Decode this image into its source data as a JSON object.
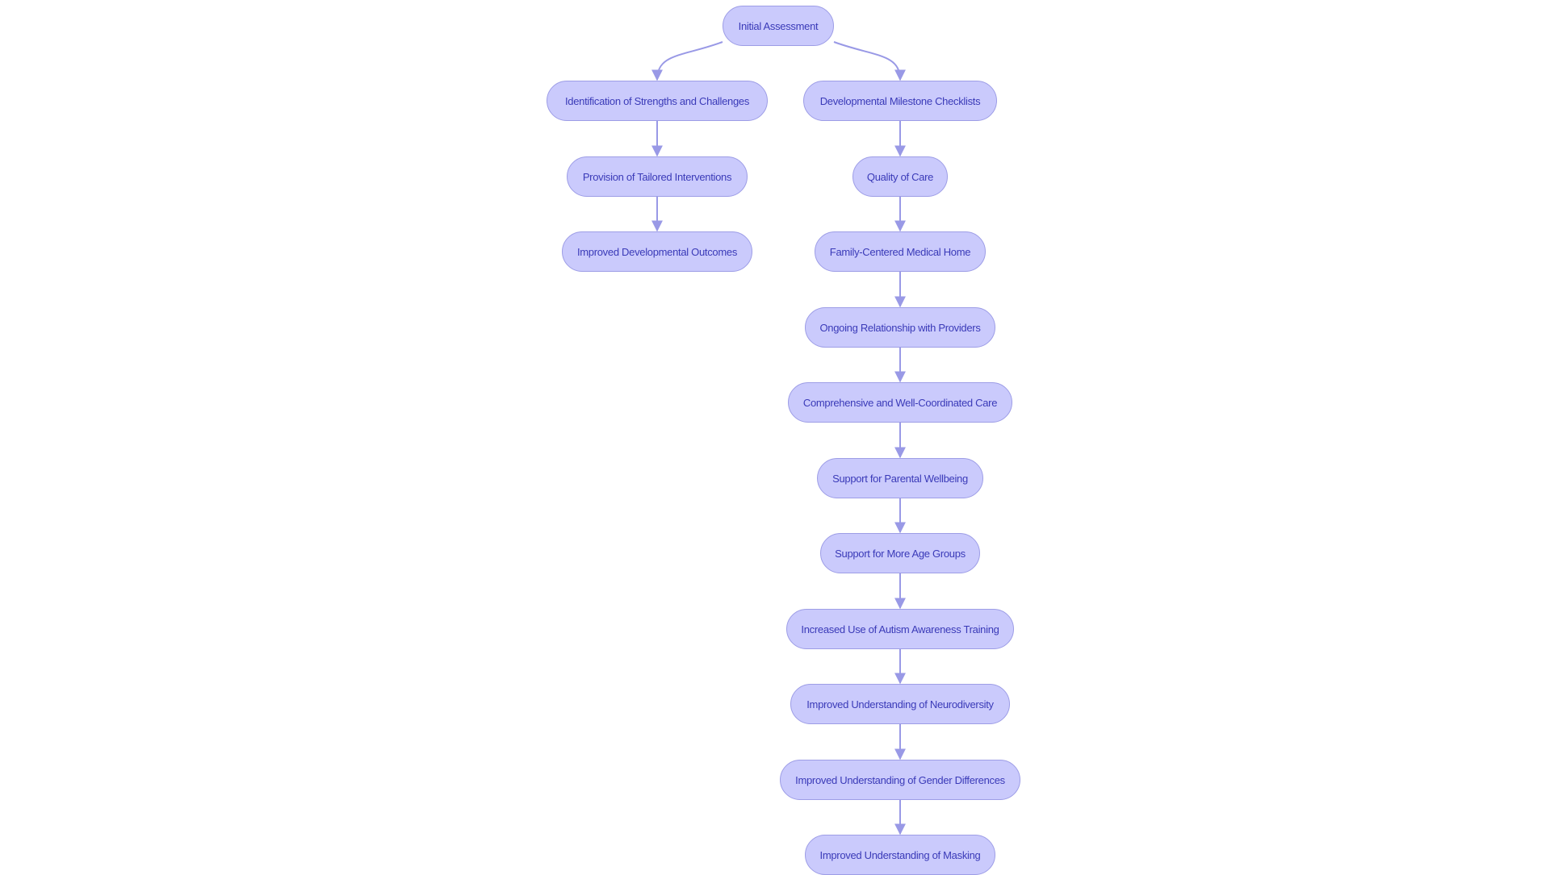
{
  "diagram": {
    "type": "flowchart",
    "colors": {
      "node_fill": "#cacafc",
      "node_border": "#9d9de6",
      "node_text": "#3a3ab8",
      "edge": "#9999e6"
    },
    "nodes": [
      {
        "id": "n0",
        "label": "Initial Assessment"
      },
      {
        "id": "n1",
        "label": "Identification of Strengths and Challenges"
      },
      {
        "id": "n2",
        "label": "Provision of Tailored Interventions"
      },
      {
        "id": "n3",
        "label": "Improved Developmental Outcomes"
      },
      {
        "id": "n4",
        "label": "Developmental Milestone Checklists"
      },
      {
        "id": "n5",
        "label": "Quality of Care"
      },
      {
        "id": "n6",
        "label": "Family-Centered Medical Home"
      },
      {
        "id": "n7",
        "label": "Ongoing Relationship with Providers"
      },
      {
        "id": "n8",
        "label": "Comprehensive and Well-Coordinated Care"
      },
      {
        "id": "n9",
        "label": "Support for Parental Wellbeing"
      },
      {
        "id": "n10",
        "label": "Support for More Age Groups"
      },
      {
        "id": "n11",
        "label": "Increased Use of Autism Awareness Training"
      },
      {
        "id": "n12",
        "label": "Improved Understanding of Neurodiversity"
      },
      {
        "id": "n13",
        "label": "Improved Understanding of Gender Differences"
      },
      {
        "id": "n14",
        "label": "Improved Understanding of Masking"
      }
    ],
    "edges": [
      [
        "n0",
        "n1"
      ],
      [
        "n1",
        "n2"
      ],
      [
        "n2",
        "n3"
      ],
      [
        "n0",
        "n4"
      ],
      [
        "n4",
        "n5"
      ],
      [
        "n5",
        "n6"
      ],
      [
        "n6",
        "n7"
      ],
      [
        "n7",
        "n8"
      ],
      [
        "n8",
        "n9"
      ],
      [
        "n9",
        "n10"
      ],
      [
        "n10",
        "n11"
      ],
      [
        "n11",
        "n12"
      ],
      [
        "n12",
        "n13"
      ],
      [
        "n13",
        "n14"
      ]
    ]
  }
}
